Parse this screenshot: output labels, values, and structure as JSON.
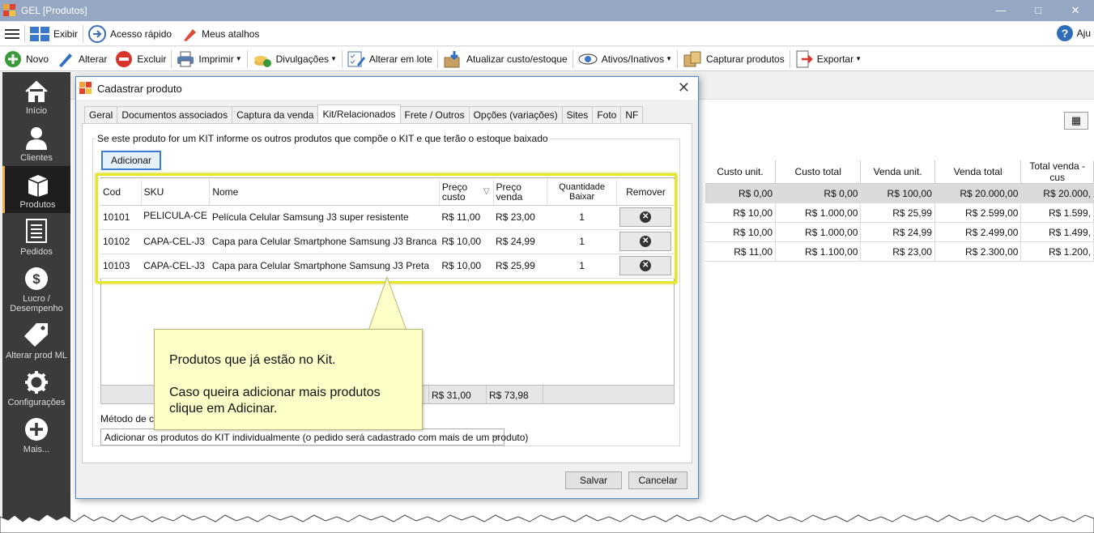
{
  "window": {
    "title": "GEL [Produtos]",
    "controls": [
      "—",
      "□",
      "✕"
    ],
    "logo_colors": [
      "#f2a33a",
      "#e0432b",
      "#3c8fdd",
      "#f0c23c"
    ]
  },
  "menubar": {
    "exibir": "Exibir",
    "acesso_rapido": "Acesso rápido",
    "meus_atalhos": "Meus atalhos",
    "ajuda": "Aju"
  },
  "toolbar": {
    "novo": "Novo",
    "alterar": "Alterar",
    "excluir": "Excluir",
    "imprimir": "Imprimir",
    "divulgacoes": "Divulgações",
    "alterar_lote": "Alterar em lote",
    "atualizar_custo": "Atualizar custo/estoque",
    "ativos_inativos": "Ativos/Inativos",
    "capturar_produtos": "Capturar produtos",
    "exportar": "Exportar"
  },
  "sidebar": {
    "items": [
      {
        "label": "Início",
        "icon": "home-icon"
      },
      {
        "label": "Clientes",
        "icon": "user-icon"
      },
      {
        "label": "Produtos",
        "icon": "box-icon",
        "active": true
      },
      {
        "label": "Pedidos",
        "icon": "document-icon"
      },
      {
        "label": "Lucro / Desempenho",
        "icon": "dollar-icon"
      },
      {
        "label": "Alterar prod ML",
        "icon": "tag-icon"
      },
      {
        "label": "Configurações",
        "icon": "gear-icon"
      },
      {
        "label": "Mais...",
        "icon": "plus-icon"
      }
    ]
  },
  "background_table": {
    "headers": [
      "Custo unit.",
      "Custo total",
      "Venda unit.",
      "Venda total",
      "Total venda - cus"
    ],
    "rows": [
      [
        "R$ 0,00",
        "R$ 0,00",
        "R$ 100,00",
        "R$ 20.000,00",
        "R$ 20.000,"
      ],
      [
        "R$ 10,00",
        "R$ 1.000,00",
        "R$ 25,99",
        "R$ 2.599,00",
        "R$ 1.599,"
      ],
      [
        "R$ 10,00",
        "R$ 1.000,00",
        "R$ 24,99",
        "R$ 2.499,00",
        "R$ 1.499,"
      ],
      [
        "R$ 11,00",
        "R$ 1.100,00",
        "R$ 23,00",
        "R$ 2.300,00",
        "R$ 1.200,"
      ]
    ]
  },
  "dialog": {
    "title": "Cadastrar produto",
    "tabs": [
      "Geral",
      "Documentos associados",
      "Captura da venda",
      "Kit/Relacionados",
      "Frete / Outros",
      "Opções (variações)",
      "Sites",
      "Foto",
      "NF"
    ],
    "active_tab": "Kit/Relacionados",
    "group_label": "Se este produto for um KIT informe os outros produtos que compõe o KIT e que terão o estoque baixado",
    "add_button": "Adicionar",
    "kit_table": {
      "headers": {
        "cod": "Cod",
        "sku": "SKU",
        "nome": "Nome",
        "preco_custo": "Preço custo",
        "preco_venda": "Preço venda",
        "quantidade": "Quantidade Baixar",
        "remover": "Remover"
      },
      "rows": [
        {
          "cod": "10101",
          "sku": "PELICULA-CE",
          "nome": "Película Celular Samsung J3 super resistente",
          "custo": "R$ 11,00",
          "venda": "R$ 23,00",
          "qtd": "1"
        },
        {
          "cod": "10102",
          "sku": "CAPA-CEL-J3",
          "nome": "Capa para Celular Smartphone Samsung J3 Branca",
          "custo": "R$ 10,00",
          "venda": "R$ 24,99",
          "qtd": "1"
        },
        {
          "cod": "10103",
          "sku": "CAPA-CEL-J3",
          "nome": "Capa para Celular Smartphone Samsung J3 Preta",
          "custo": "R$ 10,00",
          "venda": "R$ 25,99",
          "qtd": "1"
        }
      ]
    },
    "totals": {
      "custo": "R$ 31,00",
      "venda": "R$ 73,98"
    },
    "method_label": "Método de ca",
    "method_value": "Adicionar os produtos do KIT individualmente (o pedido será cadastrado com mais de um produto)",
    "save": "Salvar",
    "cancel": "Cancelar"
  },
  "callout": {
    "line1": "Produtos que já estão no Kit.",
    "line2": "Caso queira adicionar mais produtos clique em Adicinar."
  },
  "colors": {
    "highlight": "#e6e62c",
    "callout_bg": "#fefec8",
    "sidebar_bg": "#3b3b3b",
    "active_accent": "#f2b24a",
    "titlebar": "#95a7c2"
  }
}
